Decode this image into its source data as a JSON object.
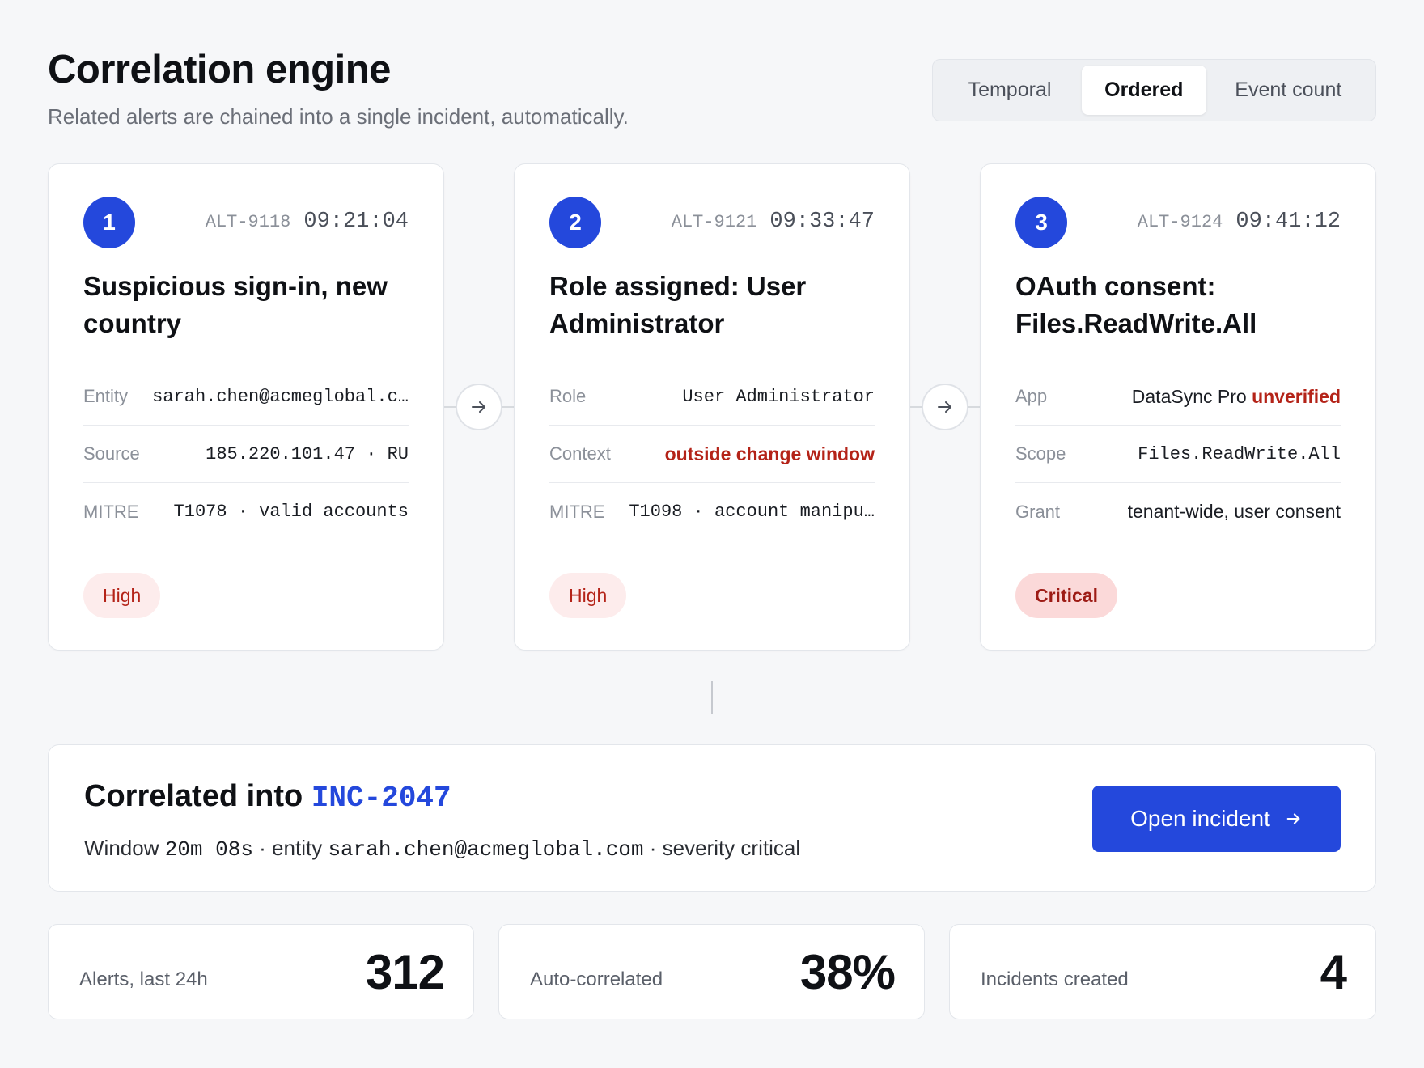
{
  "header": {
    "title": "Correlation engine",
    "subtitle": "Related alerts are chained into a single incident, automatically."
  },
  "modes": {
    "options": [
      "Temporal",
      "Ordered",
      "Event count"
    ],
    "selected": "Ordered"
  },
  "alerts": [
    {
      "step": "1",
      "id": "ALT-9118",
      "time": "09:21:04",
      "title": "Suspicious sign-in, new country",
      "rows": [
        {
          "key": "Entity",
          "value": "sarah.chen@acmeglobal.c…"
        },
        {
          "key": "Source",
          "value": "185.220.101.47 · RU"
        },
        {
          "key": "MITRE",
          "value": "T1078 · valid accounts"
        }
      ],
      "severity": "High"
    },
    {
      "step": "2",
      "id": "ALT-9121",
      "time": "09:33:47",
      "title": "Role assigned: User Administrator",
      "rows": [
        {
          "key": "Role",
          "value": "User Administrator"
        },
        {
          "key": "Context",
          "value": "outside change window"
        },
        {
          "key": "MITRE",
          "value": "T1098 · account manipu…"
        }
      ],
      "severity": "High"
    },
    {
      "step": "3",
      "id": "ALT-9124",
      "time": "09:41:12",
      "title": "OAuth consent: Files.ReadWrite.All",
      "rows": [
        {
          "key": "App",
          "value": "DataSync Pro",
          "flag": "unverified"
        },
        {
          "key": "Scope",
          "value": "Files.ReadWrite.All"
        },
        {
          "key": "Grant",
          "value": "tenant-wide, user consent"
        }
      ],
      "severity": "Critical"
    }
  ],
  "incident": {
    "prefix": "Correlated into",
    "id": "INC-2047",
    "window_label": "Window",
    "window_value": "20m 08s",
    "entity_label": "· entity",
    "entity_value": "sarah.chen@acmeglobal.com",
    "severity_text": "· severity critical",
    "button_label": "Open incident"
  },
  "stats": [
    {
      "label": "Alerts, last 24h",
      "value": "312"
    },
    {
      "label": "Auto-correlated",
      "value": "38%"
    },
    {
      "label": "Incidents created",
      "value": "4"
    }
  ],
  "colors": {
    "accent": "#2448dc",
    "danger": "#b42318",
    "high_badge_bg": "#fdecec",
    "critical_badge_bg": "#fbd9d9"
  },
  "icons": {
    "chain_arrow": "arrow-right-icon",
    "button_arrow": "arrow-right-icon"
  }
}
